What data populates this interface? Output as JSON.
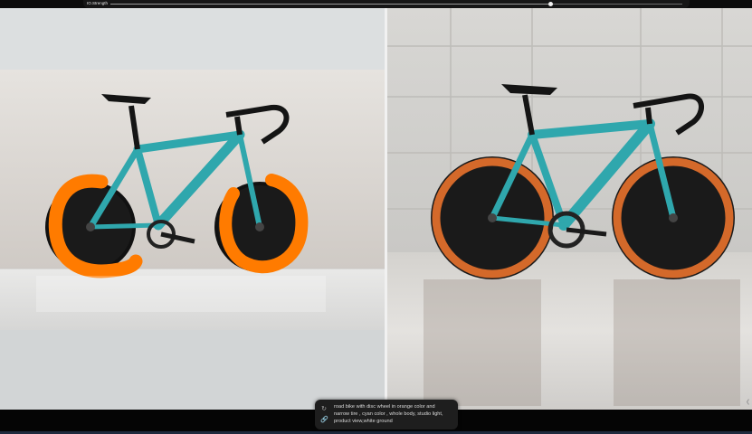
{
  "slider": {
    "label": "IO.Strength",
    "value_fraction": 0.77
  },
  "prompt": {
    "lines": [
      "road bike with disc wheel in orange color and",
      "narrow tire , cyan color , whole body, studio light,",
      "product view,white  ground"
    ],
    "icons": [
      "refresh-icon",
      "link-icon"
    ]
  },
  "images": {
    "left": "sketch-input-bike",
    "right": "generated-output-bike"
  },
  "colors": {
    "frame_cyan": "#2fa7ad",
    "orange": "#ff7b00",
    "orange_rim": "#d4692a",
    "background": "#0b0b0b"
  }
}
